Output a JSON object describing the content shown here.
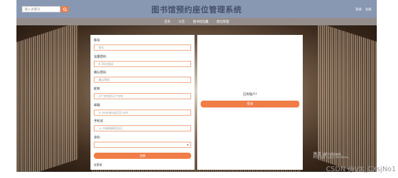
{
  "header": {
    "title": "图书馆预约座位管理系统",
    "search_placeholder": "输入关键词",
    "links": [
      "登录",
      "注册"
    ]
  },
  "nav": [
    "首页",
    "公告",
    "图书馆馆藏",
    "座位管理"
  ],
  "form": {
    "fields": [
      {
        "label": "账号",
        "placeholder": "账号"
      },
      {
        "label": "设置密码",
        "placeholder": "6-16位密码"
      },
      {
        "label": "确认密码",
        "placeholder": "确认密码"
      },
      {
        "label": "昵称",
        "placeholder": "2个字符到12个字符"
      },
      {
        "label": "邮箱",
        "placeholder": "example@123.com"
      },
      {
        "label": "手机号",
        "placeholder": "18888882222"
      },
      {
        "label": "身份",
        "placeholder": ""
      }
    ],
    "register_button": "注册",
    "footer_link": "去登录"
  },
  "right_panel": {
    "prompt": "已有账户?",
    "login_button": "登录"
  },
  "watermark": {
    "line1": "激活 Windows",
    "line2": "转到\"设置\"以激活 Windows。",
    "credit": "CSDN @VX_CXsjNo1"
  },
  "colors": {
    "accent": "#f07c48",
    "topbar": "#8898b2",
    "navbar": "#958c8c"
  }
}
